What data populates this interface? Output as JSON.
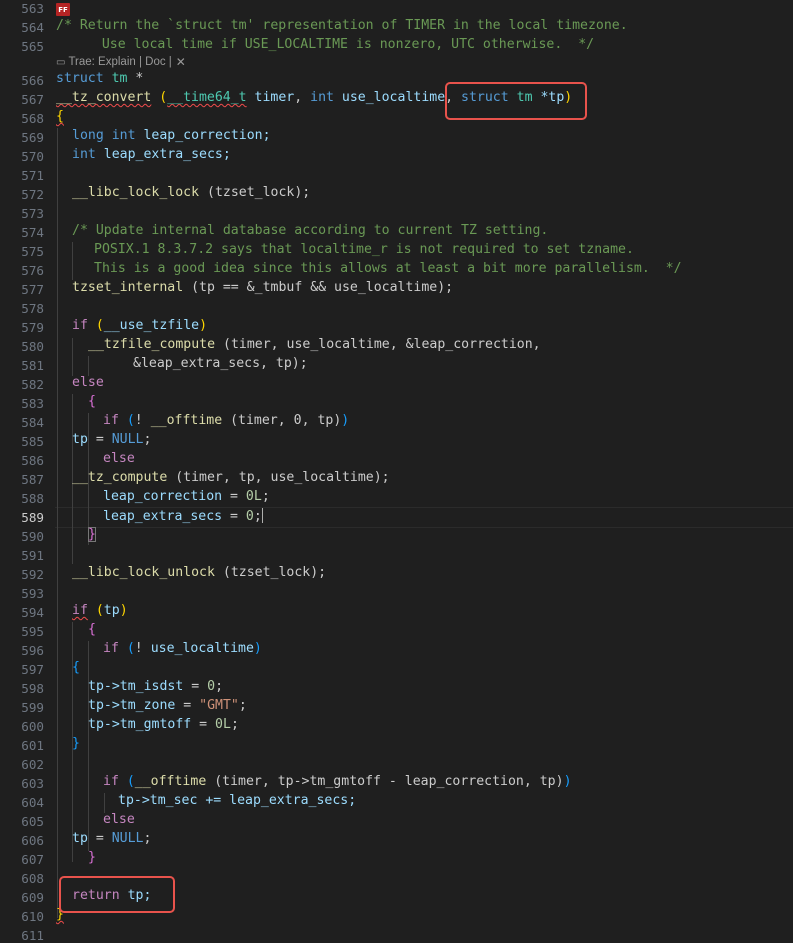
{
  "editor": {
    "active_line": "589",
    "ff_badge": "FF",
    "codelens": {
      "label": "Trae: Explain | Doc |"
    },
    "line_numbers": [
      "563",
      "564",
      "565",
      "566",
      "567",
      "568",
      "569",
      "570",
      "571",
      "572",
      "573",
      "574",
      "575",
      "576",
      "577",
      "578",
      "579",
      "580",
      "581",
      "582",
      "583",
      "584",
      "585",
      "586",
      "587",
      "588",
      "589",
      "590",
      "591",
      "592",
      "593",
      "594",
      "595",
      "596",
      "597",
      "598",
      "599",
      "600",
      "601",
      "602",
      "603",
      "604",
      "605",
      "606",
      "607",
      "608",
      "609",
      "610",
      "611"
    ],
    "code": {
      "l564": "/* Return the `struct tm' representation of TIMER in the local timezone.",
      "l565": "   Use local time if USE_LOCALTIME is nonzero, UTC otherwise.  */",
      "l566_kw": "struct",
      "l566_ty": "tm",
      "l566_rest": " *",
      "l567_fn": "__tz_convert",
      "l567_p": "(",
      "l567_ty": "__time64_t",
      "l567_v1": "timer",
      "l567_kw": "int",
      "l567_v2": "use_localtime",
      "l567_kw2": "struct",
      "l567_ty2": "tm",
      "l567_v3": "*tp",
      "l567_pc": ")",
      "l568": "{",
      "l569_kw": "long int",
      "l569_v": "leap_correction;",
      "l570_kw": "int",
      "l570_v": "leap_extra_secs;",
      "l572_fn": "__libc_lock_lock",
      "l572_rest": "(tzset_lock);",
      "l574": "/* Update internal database according to current TZ setting.",
      "l575": "POSIX.1 8.3.7.2 says that localtime_r is not required to set tzname.",
      "l576": "This is a good idea since this allows at least a bit more parallelism.  */",
      "l577_fn": "tzset_internal",
      "l577_rest": "(tp == &_tmbuf && use_localtime);",
      "l579_kw": "if",
      "l579_v": "__use_tzfile",
      "l580_fn": "__tzfile_compute",
      "l580_rest": "(timer, use_localtime, &leap_correction,",
      "l581": "&leap_extra_secs, tp);",
      "l582": "else",
      "l583": "{",
      "l584_kw": "if",
      "l584_fn": "__offtime",
      "l584_rest": "(timer, 0, tp)",
      "l585_v": "tp",
      "l585_null": "NULL",
      "l586": "else",
      "l587_fn": "__tz_compute",
      "l587_rest": "(timer, tp, use_localtime);",
      "l588_v": "leap_correction",
      "l588_n": "0L",
      "l589_v": "leap_extra_secs",
      "l589_n": "0",
      "l590": "}",
      "l592_fn": "__libc_lock_unlock",
      "l592_rest": "(tzset_lock);",
      "l594_kw": "if",
      "l594_v": "tp",
      "l595": "{",
      "l596_kw": "if",
      "l596_v": "use_localtime",
      "l597": "{",
      "l598_v": "tp->tm_isdst",
      "l598_n": "0",
      "l599_v": "tp->tm_zone",
      "l599_s": "\"GMT\"",
      "l600_v": "tp->tm_gmtoff",
      "l600_n": "0L",
      "l601": "}",
      "l603_kw": "if",
      "l603_fn": "__offtime",
      "l603_rest": "(timer, tp->tm_gmtoff - leap_correction, tp)",
      "l604_v": "tp->tm_sec += leap_extra_secs;",
      "l605": "else",
      "l606_v": "tp",
      "l606_null": "NULL",
      "l607": "}",
      "l609_kw": "return",
      "l609_v": "tp;",
      "l610": "}"
    }
  }
}
